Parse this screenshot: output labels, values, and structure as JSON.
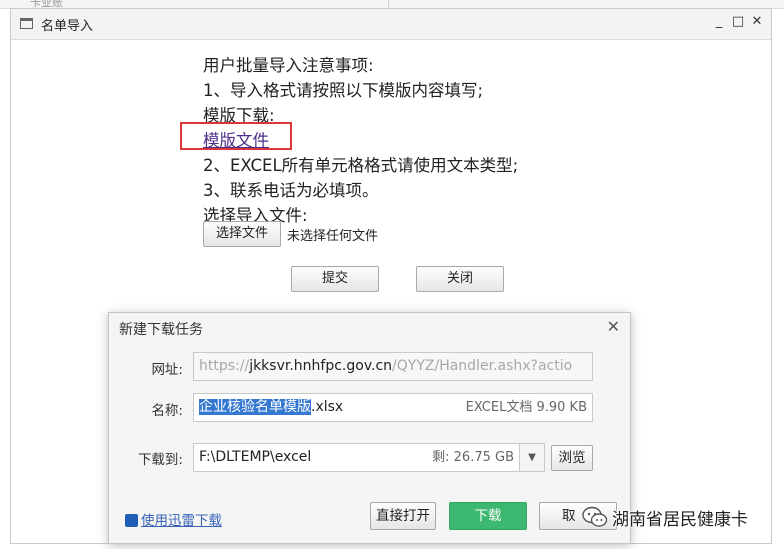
{
  "background": {
    "top_label": "卡业账"
  },
  "window": {
    "title": "名单导入",
    "controls": {
      "minimize": "_",
      "maximize": "□",
      "close": "✕"
    }
  },
  "instructions": {
    "heading": "用户批量导入注意事项:",
    "item1": "1、导入格式请按照以下模版内容填写;",
    "template_label": "模版下载:",
    "template_link": "模版文件",
    "item2": "2、EXCEL所有单元格格式请使用文本类型;",
    "item3": "3、联系电话为必填项。",
    "select_label": "选择导入文件:"
  },
  "file_input": {
    "button": "选择文件",
    "status": "未选择任何文件"
  },
  "actions": {
    "submit": "提交",
    "close": "关闭"
  },
  "download_dialog": {
    "title": "新建下载任务",
    "close_glyph": "✕",
    "url_label": "网址:",
    "url_prefix": "https://",
    "url_host": "jkksvr.hnhfpc.gov.cn",
    "url_suffix": "/QYYZ/Handler.ashx?actio",
    "name_label": "名称:",
    "name_selected": "企业核验名单模版",
    "name_ext": ".xlsx",
    "name_size": "EXCEL文档 9.90 KB",
    "path_label": "下载到:",
    "path": "F:\\DLTEMP\\excel",
    "free_space": "剩: 26.75 GB",
    "browse": "浏览",
    "thunder_link": "使用迅雷下载",
    "open_button": "直接打开",
    "download_button": "下载",
    "cancel_button": "取"
  },
  "watermark": {
    "text": "湖南省居民健康卡"
  },
  "colors": {
    "accent_green": "#3cb870",
    "selection_blue": "#3478d2",
    "highlight_red": "#d9363e",
    "link_purple": "#4d2e8a"
  }
}
